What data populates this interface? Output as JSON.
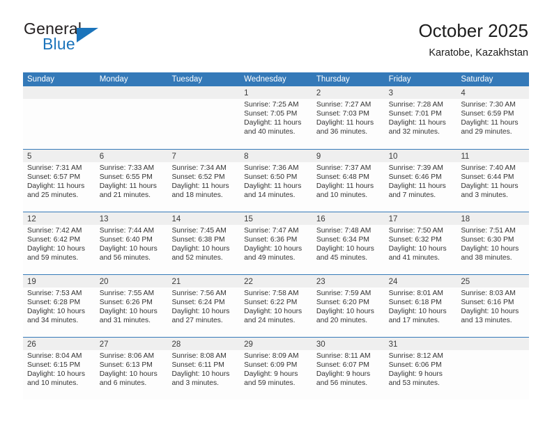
{
  "brand": {
    "word_one": "General",
    "word_two": "Blue",
    "logo_icon": "triangle-logo-icon",
    "accent_color": "#1b74bb"
  },
  "header": {
    "title": "October 2025",
    "subtitle": "Karatobe, Kazakhstan"
  },
  "colors": {
    "header_bar": "#3479b8",
    "day_number_bar": "#efefef",
    "text": "#333333"
  },
  "weekdays": [
    "Sunday",
    "Monday",
    "Tuesday",
    "Wednesday",
    "Thursday",
    "Friday",
    "Saturday"
  ],
  "weeks": [
    [
      {
        "day": "",
        "empty": true
      },
      {
        "day": "",
        "empty": true
      },
      {
        "day": "",
        "empty": true
      },
      {
        "day": "1",
        "sunrise": "Sunrise: 7:25 AM",
        "sunset": "Sunset: 7:05 PM",
        "daylight_1": "Daylight: 11 hours",
        "daylight_2": "and 40 minutes."
      },
      {
        "day": "2",
        "sunrise": "Sunrise: 7:27 AM",
        "sunset": "Sunset: 7:03 PM",
        "daylight_1": "Daylight: 11 hours",
        "daylight_2": "and 36 minutes."
      },
      {
        "day": "3",
        "sunrise": "Sunrise: 7:28 AM",
        "sunset": "Sunset: 7:01 PM",
        "daylight_1": "Daylight: 11 hours",
        "daylight_2": "and 32 minutes."
      },
      {
        "day": "4",
        "sunrise": "Sunrise: 7:30 AM",
        "sunset": "Sunset: 6:59 PM",
        "daylight_1": "Daylight: 11 hours",
        "daylight_2": "and 29 minutes."
      }
    ],
    [
      {
        "day": "5",
        "sunrise": "Sunrise: 7:31 AM",
        "sunset": "Sunset: 6:57 PM",
        "daylight_1": "Daylight: 11 hours",
        "daylight_2": "and 25 minutes."
      },
      {
        "day": "6",
        "sunrise": "Sunrise: 7:33 AM",
        "sunset": "Sunset: 6:55 PM",
        "daylight_1": "Daylight: 11 hours",
        "daylight_2": "and 21 minutes."
      },
      {
        "day": "7",
        "sunrise": "Sunrise: 7:34 AM",
        "sunset": "Sunset: 6:52 PM",
        "daylight_1": "Daylight: 11 hours",
        "daylight_2": "and 18 minutes."
      },
      {
        "day": "8",
        "sunrise": "Sunrise: 7:36 AM",
        "sunset": "Sunset: 6:50 PM",
        "daylight_1": "Daylight: 11 hours",
        "daylight_2": "and 14 minutes."
      },
      {
        "day": "9",
        "sunrise": "Sunrise: 7:37 AM",
        "sunset": "Sunset: 6:48 PM",
        "daylight_1": "Daylight: 11 hours",
        "daylight_2": "and 10 minutes."
      },
      {
        "day": "10",
        "sunrise": "Sunrise: 7:39 AM",
        "sunset": "Sunset: 6:46 PM",
        "daylight_1": "Daylight: 11 hours",
        "daylight_2": "and 7 minutes."
      },
      {
        "day": "11",
        "sunrise": "Sunrise: 7:40 AM",
        "sunset": "Sunset: 6:44 PM",
        "daylight_1": "Daylight: 11 hours",
        "daylight_2": "and 3 minutes."
      }
    ],
    [
      {
        "day": "12",
        "sunrise": "Sunrise: 7:42 AM",
        "sunset": "Sunset: 6:42 PM",
        "daylight_1": "Daylight: 10 hours",
        "daylight_2": "and 59 minutes."
      },
      {
        "day": "13",
        "sunrise": "Sunrise: 7:44 AM",
        "sunset": "Sunset: 6:40 PM",
        "daylight_1": "Daylight: 10 hours",
        "daylight_2": "and 56 minutes."
      },
      {
        "day": "14",
        "sunrise": "Sunrise: 7:45 AM",
        "sunset": "Sunset: 6:38 PM",
        "daylight_1": "Daylight: 10 hours",
        "daylight_2": "and 52 minutes."
      },
      {
        "day": "15",
        "sunrise": "Sunrise: 7:47 AM",
        "sunset": "Sunset: 6:36 PM",
        "daylight_1": "Daylight: 10 hours",
        "daylight_2": "and 49 minutes."
      },
      {
        "day": "16",
        "sunrise": "Sunrise: 7:48 AM",
        "sunset": "Sunset: 6:34 PM",
        "daylight_1": "Daylight: 10 hours",
        "daylight_2": "and 45 minutes."
      },
      {
        "day": "17",
        "sunrise": "Sunrise: 7:50 AM",
        "sunset": "Sunset: 6:32 PM",
        "daylight_1": "Daylight: 10 hours",
        "daylight_2": "and 41 minutes."
      },
      {
        "day": "18",
        "sunrise": "Sunrise: 7:51 AM",
        "sunset": "Sunset: 6:30 PM",
        "daylight_1": "Daylight: 10 hours",
        "daylight_2": "and 38 minutes."
      }
    ],
    [
      {
        "day": "19",
        "sunrise": "Sunrise: 7:53 AM",
        "sunset": "Sunset: 6:28 PM",
        "daylight_1": "Daylight: 10 hours",
        "daylight_2": "and 34 minutes."
      },
      {
        "day": "20",
        "sunrise": "Sunrise: 7:55 AM",
        "sunset": "Sunset: 6:26 PM",
        "daylight_1": "Daylight: 10 hours",
        "daylight_2": "and 31 minutes."
      },
      {
        "day": "21",
        "sunrise": "Sunrise: 7:56 AM",
        "sunset": "Sunset: 6:24 PM",
        "daylight_1": "Daylight: 10 hours",
        "daylight_2": "and 27 minutes."
      },
      {
        "day": "22",
        "sunrise": "Sunrise: 7:58 AM",
        "sunset": "Sunset: 6:22 PM",
        "daylight_1": "Daylight: 10 hours",
        "daylight_2": "and 24 minutes."
      },
      {
        "day": "23",
        "sunrise": "Sunrise: 7:59 AM",
        "sunset": "Sunset: 6:20 PM",
        "daylight_1": "Daylight: 10 hours",
        "daylight_2": "and 20 minutes."
      },
      {
        "day": "24",
        "sunrise": "Sunrise: 8:01 AM",
        "sunset": "Sunset: 6:18 PM",
        "daylight_1": "Daylight: 10 hours",
        "daylight_2": "and 17 minutes."
      },
      {
        "day": "25",
        "sunrise": "Sunrise: 8:03 AM",
        "sunset": "Sunset: 6:16 PM",
        "daylight_1": "Daylight: 10 hours",
        "daylight_2": "and 13 minutes."
      }
    ],
    [
      {
        "day": "26",
        "sunrise": "Sunrise: 8:04 AM",
        "sunset": "Sunset: 6:15 PM",
        "daylight_1": "Daylight: 10 hours",
        "daylight_2": "and 10 minutes."
      },
      {
        "day": "27",
        "sunrise": "Sunrise: 8:06 AM",
        "sunset": "Sunset: 6:13 PM",
        "daylight_1": "Daylight: 10 hours",
        "daylight_2": "and 6 minutes."
      },
      {
        "day": "28",
        "sunrise": "Sunrise: 8:08 AM",
        "sunset": "Sunset: 6:11 PM",
        "daylight_1": "Daylight: 10 hours",
        "daylight_2": "and 3 minutes."
      },
      {
        "day": "29",
        "sunrise": "Sunrise: 8:09 AM",
        "sunset": "Sunset: 6:09 PM",
        "daylight_1": "Daylight: 9 hours",
        "daylight_2": "and 59 minutes."
      },
      {
        "day": "30",
        "sunrise": "Sunrise: 8:11 AM",
        "sunset": "Sunset: 6:07 PM",
        "daylight_1": "Daylight: 9 hours",
        "daylight_2": "and 56 minutes."
      },
      {
        "day": "31",
        "sunrise": "Sunrise: 8:12 AM",
        "sunset": "Sunset: 6:06 PM",
        "daylight_1": "Daylight: 9 hours",
        "daylight_2": "and 53 minutes."
      },
      {
        "day": "",
        "empty": true
      }
    ]
  ]
}
